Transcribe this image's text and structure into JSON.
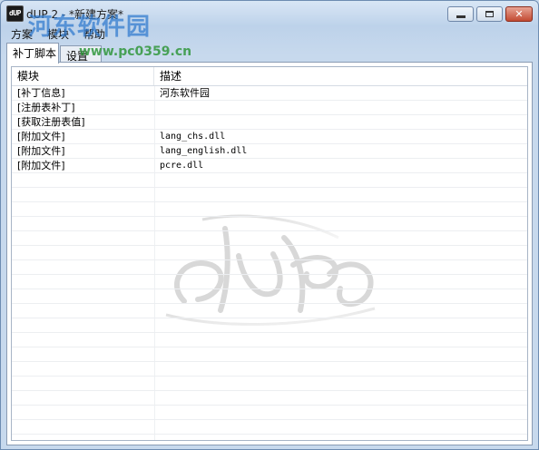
{
  "window": {
    "app_icon_text": "dUP",
    "title": "dUP 2 - *新建方案*"
  },
  "watermark": {
    "site_name": "河东软件园",
    "url": "www.pc0359.cn"
  },
  "menu": [
    "方案",
    "模块",
    "帮助"
  ],
  "tabs": [
    "补丁脚本",
    "设置"
  ],
  "columns": [
    "模块",
    "描述"
  ],
  "rows": [
    {
      "module": "[补丁信息]",
      "desc": "河东软件园"
    },
    {
      "module": "[注册表补丁]",
      "desc": ""
    },
    {
      "module": "[获取注册表值]",
      "desc": ""
    },
    {
      "module": "[附加文件]",
      "desc": "lang_chs.dll"
    },
    {
      "module": "[附加文件]",
      "desc": "lang_english.dll"
    },
    {
      "module": "[附加文件]",
      "desc": "pcre.dll"
    }
  ],
  "empty_row_count": 18,
  "colors": {
    "title_bg": "#bdd2ea",
    "close_button": "#c24a32",
    "watermark_blue": "#2e78cd",
    "watermark_green": "#30963c"
  },
  "icons": [
    "app-icon",
    "minimize-icon",
    "maximize-icon",
    "close-icon",
    "dup-logo"
  ]
}
